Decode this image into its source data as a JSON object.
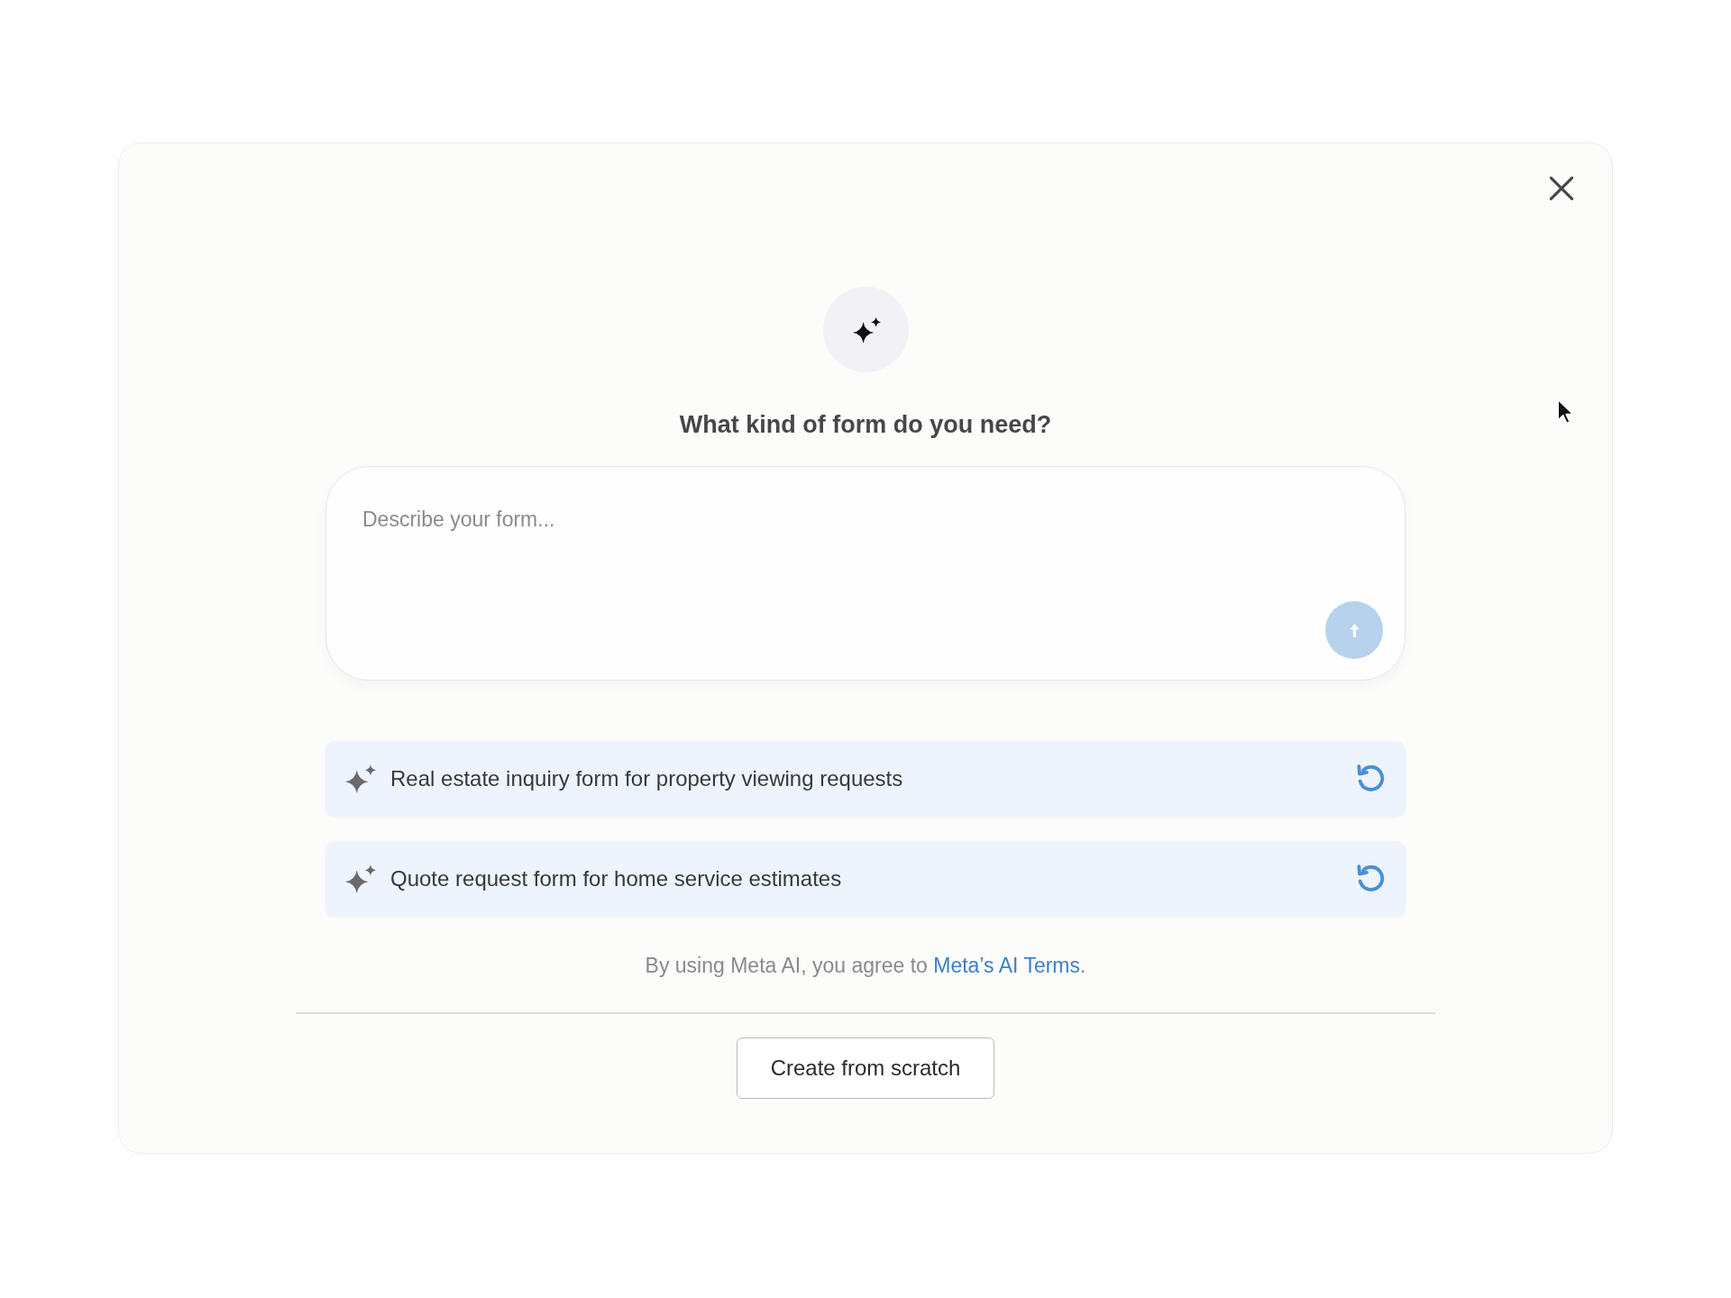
{
  "dialog": {
    "title": "What kind of form do you need?",
    "prompt_field": {
      "placeholder": "Describe your form..."
    },
    "send_button": {
      "disabled": true
    },
    "suggestions": [
      {
        "text": "Real estate inquiry form for property viewing requests"
      },
      {
        "text": "Quote request form for home service estimates"
      }
    ],
    "terms_notice": {
      "text_before": "By using Meta AI, you agree to ",
      "link": "Meta’s AI Terms",
      "text_after": "."
    },
    "buttons": [
      "Create from scratch"
    ]
  }
}
